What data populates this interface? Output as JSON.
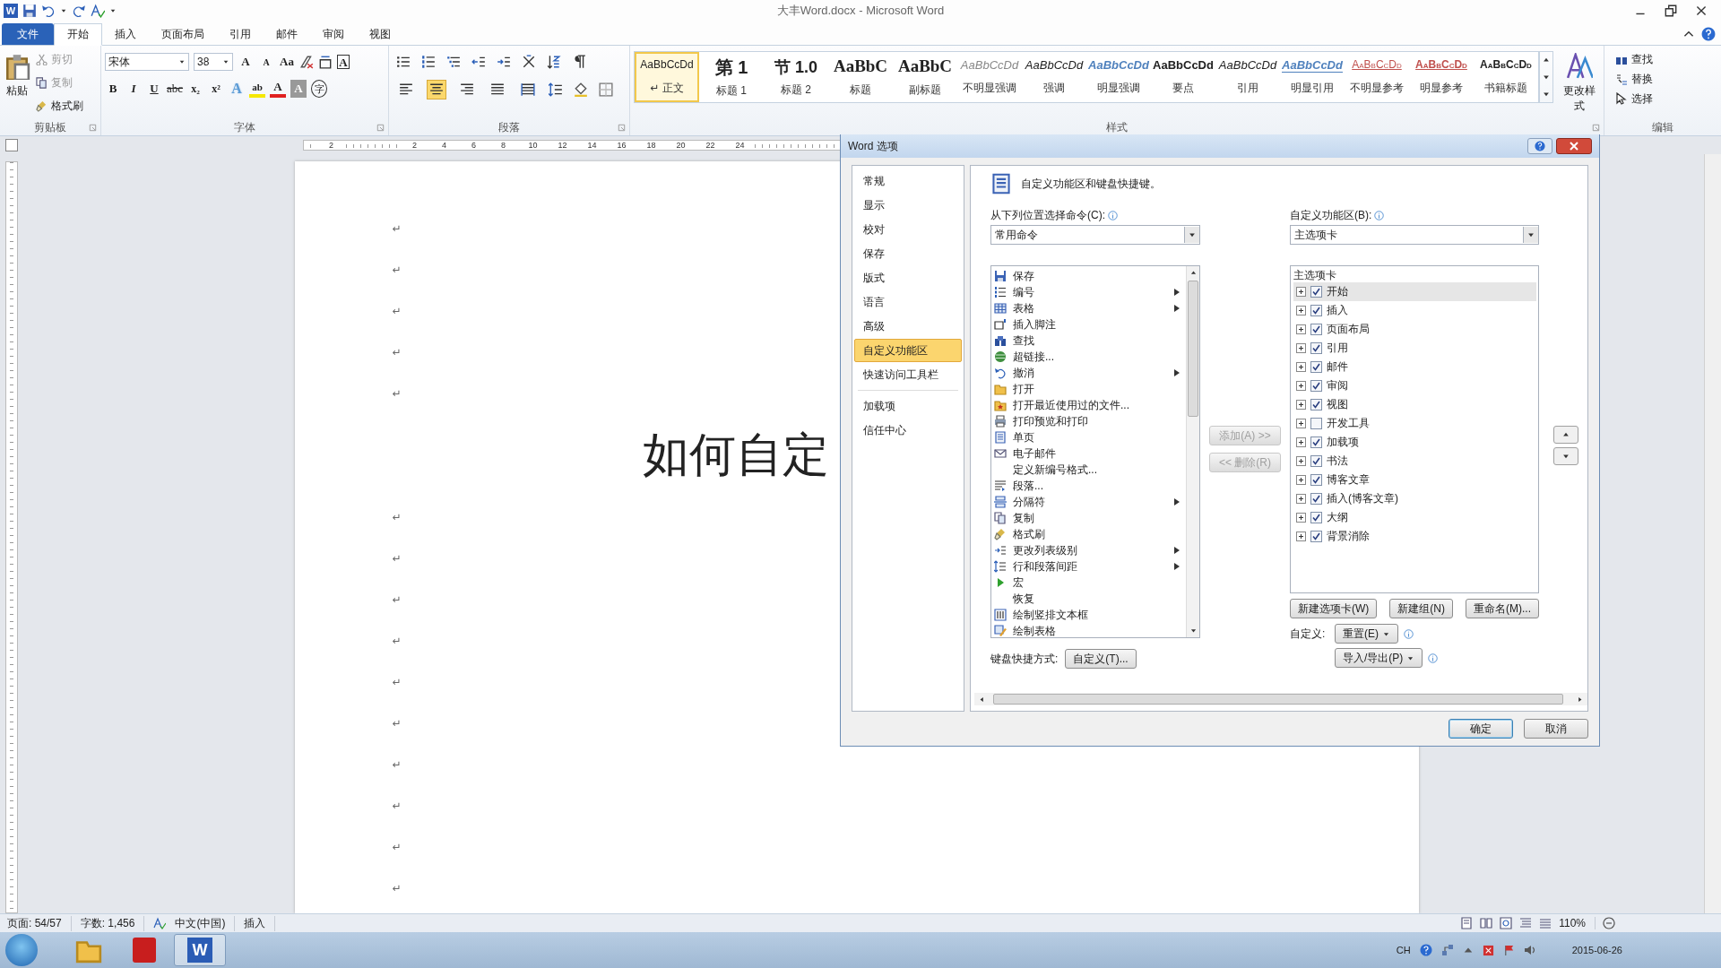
{
  "window": {
    "title": "大丰Word.docx - Microsoft Word",
    "logo": "W"
  },
  "ribbon_tabs": [
    {
      "label": "文件",
      "kind": "file",
      "selected": false
    },
    {
      "label": "开始",
      "kind": "tab",
      "selected": true
    },
    {
      "label": "插入",
      "kind": "tab",
      "selected": false
    },
    {
      "label": "页面布局",
      "kind": "tab",
      "selected": false
    },
    {
      "label": "引用",
      "kind": "tab",
      "selected": false
    },
    {
      "label": "邮件",
      "kind": "tab",
      "selected": false
    },
    {
      "label": "审阅",
      "kind": "tab",
      "selected": false
    },
    {
      "label": "视图",
      "kind": "tab",
      "selected": false
    }
  ],
  "clipboard": {
    "group": "剪贴板",
    "paste": "粘贴",
    "items": [
      {
        "label": "剪切",
        "disabled": true
      },
      {
        "label": "复制",
        "disabled": true
      },
      {
        "label": "格式刷",
        "disabled": false
      }
    ]
  },
  "font": {
    "group": "字体",
    "name": "宋体",
    "size": "38",
    "tools": [
      {
        "label": "A",
        "kind": "grow"
      },
      {
        "label": "A",
        "kind": "shrink"
      },
      {
        "label": "Aa",
        "kind": "case"
      },
      {
        "label": "A",
        "kind": "border"
      }
    ],
    "format_buttons": [
      {
        "label": "B",
        "kind": "bold"
      },
      {
        "label": "I",
        "kind": "italic"
      },
      {
        "label": "U",
        "kind": "underline"
      },
      {
        "label": "abc",
        "kind": "strike"
      },
      {
        "label": "x₂",
        "kind": "sub"
      },
      {
        "label": "x²",
        "kind": "sup"
      },
      {
        "label": "A",
        "kind": "effect"
      },
      {
        "label": "ab",
        "kind": "highlight"
      },
      {
        "label": "A",
        "kind": "color"
      },
      {
        "label": "A",
        "kind": "shade"
      },
      {
        "label": "字",
        "kind": "enclose"
      }
    ]
  },
  "paragraph": {
    "group": "段落",
    "alignment": [
      {
        "selected": false
      },
      {
        "selected": true
      },
      {
        "selected": false
      },
      {
        "selected": false
      },
      {
        "selected": false
      }
    ]
  },
  "styles": {
    "group": "样式",
    "change": "更改样式",
    "items": [
      {
        "preview": "AaBbCcDd",
        "name": "↵ 正文",
        "kind": "normal",
        "selected": true
      },
      {
        "preview": "第 1",
        "name": "标题 1",
        "kind": "h1",
        "selected": false
      },
      {
        "preview": "节 1.0",
        "name": "标题 2",
        "kind": "h2",
        "selected": false
      },
      {
        "preview": "AaBbC",
        "name": "标题",
        "kind": "title",
        "selected": false
      },
      {
        "preview": "AaBbC",
        "name": "副标题",
        "kind": "subtitle",
        "selected": false
      },
      {
        "preview": "AaBbCcDd",
        "name": "不明显强调",
        "kind": "subtle",
        "selected": false
      },
      {
        "preview": "AaBbCcDd",
        "name": "强调",
        "kind": "emph",
        "selected": false
      },
      {
        "preview": "AaBbCcDd",
        "name": "明显强调",
        "kind": "intense",
        "selected": false
      },
      {
        "preview": "AaBbCcDd",
        "name": "要点",
        "kind": "strong",
        "selected": false
      },
      {
        "preview": "AaBbCcDd",
        "name": "引用",
        "kind": "quote",
        "selected": false
      },
      {
        "preview": "AaBbCcDd",
        "name": "明显引用",
        "kind": "iquote",
        "selected": false
      },
      {
        "preview": "AaBbCcDd",
        "name": "不明显参考",
        "kind": "subref",
        "selected": false
      },
      {
        "preview": "AaBbCcDd",
        "name": "明显参考",
        "kind": "iref",
        "selected": false
      },
      {
        "preview": "AaBbCcDd",
        "name": "书籍标题",
        "kind": "book",
        "selected": false
      }
    ]
  },
  "editing": {
    "group": "编辑",
    "items": [
      "查找",
      "替换",
      "选择"
    ]
  },
  "ruler": {
    "labels": [
      "2",
      "2",
      "4",
      "6",
      "8",
      "10",
      "12",
      "14",
      "16",
      "18",
      "20",
      "22",
      "24"
    ]
  },
  "document": {
    "lines": [
      {
        "kind": "mark",
        "text": "↵"
      },
      {
        "kind": "mark",
        "text": "↵"
      },
      {
        "kind": "mark",
        "text": "↵"
      },
      {
        "kind": "mark",
        "text": "↵"
      },
      {
        "kind": "mark",
        "text": "↵"
      },
      {
        "kind": "title",
        "text": "如何自定"
      },
      {
        "kind": "mark",
        "text": "↵"
      },
      {
        "kind": "mark",
        "text": "↵"
      },
      {
        "kind": "mark",
        "text": "↵"
      },
      {
        "kind": "mark",
        "text": "↵"
      },
      {
        "kind": "mark",
        "text": "↵"
      },
      {
        "kind": "mark",
        "text": "↵"
      },
      {
        "kind": "mark",
        "text": "↵"
      },
      {
        "kind": "mark",
        "text": "↵"
      },
      {
        "kind": "mark",
        "text": "↵"
      },
      {
        "kind": "mark",
        "text": "↵"
      }
    ]
  },
  "status_bar": {
    "items": [
      "页面: 54/57",
      "字数: 1,456",
      "中文(中国)",
      "插入"
    ],
    "zoom": "110%"
  },
  "taskbar": {
    "apps": [
      {
        "kind": "folder",
        "selected": false
      },
      {
        "kind": "pdf",
        "selected": false
      },
      {
        "kind": "word",
        "label": "W",
        "selected": true
      }
    ],
    "lang": "CH",
    "date": "2015-06-26"
  },
  "dialog": {
    "title": "Word 选项",
    "nav": [
      {
        "label": "常规",
        "selected": false
      },
      {
        "label": "显示",
        "selected": false
      },
      {
        "label": "校对",
        "selected": false
      },
      {
        "label": "保存",
        "selected": false
      },
      {
        "label": "版式",
        "selected": false
      },
      {
        "label": "语言",
        "selected": false
      },
      {
        "label": "高级",
        "selected": false
      },
      {
        "label": "自定义功能区",
        "selected": true
      },
      {
        "label": "快速访问工具栏",
        "selected": false
      },
      {
        "label": "加载项",
        "selected": false
      },
      {
        "label": "信任中心",
        "selected": false
      }
    ],
    "heading": "自定义功能区和键盘快捷键。",
    "commands_label": "从下列位置选择命令(C):",
    "commands_source": "常用命令",
    "commands": [
      {
        "label": "保存",
        "has_submenu": false
      },
      {
        "label": "编号",
        "has_submenu": true
      },
      {
        "label": "表格",
        "has_submenu": true
      },
      {
        "label": "插入脚注",
        "has_submenu": false
      },
      {
        "label": "查找",
        "has_submenu": false
      },
      {
        "label": "超链接...",
        "has_submenu": false
      },
      {
        "label": "撤消",
        "has_submenu": true
      },
      {
        "label": "打开",
        "has_submenu": false
      },
      {
        "label": "打开最近使用过的文件...",
        "has_submenu": false
      },
      {
        "label": "打印预览和打印",
        "has_submenu": false
      },
      {
        "label": "单页",
        "has_submenu": false
      },
      {
        "label": "电子邮件",
        "has_submenu": false
      },
      {
        "label": "定义新编号格式...",
        "has_submenu": false
      },
      {
        "label": "段落...",
        "has_submenu": false
      },
      {
        "label": "分隔符",
        "has_submenu": true
      },
      {
        "label": "复制",
        "has_submenu": false
      },
      {
        "label": "格式刷",
        "has_submenu": false
      },
      {
        "label": "更改列表级别",
        "has_submenu": true
      },
      {
        "label": "行和段落间距",
        "has_submenu": true
      },
      {
        "label": "宏",
        "has_submenu": false
      },
      {
        "label": "恢复",
        "has_submenu": false
      },
      {
        "label": "绘制竖排文本框",
        "has_submenu": false
      },
      {
        "label": "绘制表格",
        "has_submenu": false
      }
    ],
    "shortcut_label": "键盘快捷方式:",
    "shortcut_button": "自定义(T)...",
    "add_button": {
      "label": "添加(A) >>",
      "disabled": true
    },
    "remove_button": {
      "label": "<< 删除(R)",
      "disabled": true
    },
    "ribbon_label": "自定义功能区(B):",
    "ribbon_source": "主选项卡",
    "tree": {
      "header": "主选项卡",
      "items": [
        {
          "label": "开始",
          "checked": true,
          "expanded": false,
          "selected": true
        },
        {
          "label": "插入",
          "checked": true,
          "expanded": false,
          "selected": false
        },
        {
          "label": "页面布局",
          "checked": true,
          "expanded": false,
          "selected": false
        },
        {
          "label": "引用",
          "checked": true,
          "expanded": false,
          "selected": false
        },
        {
          "label": "邮件",
          "checked": true,
          "expanded": false,
          "selected": false
        },
        {
          "label": "审阅",
          "checked": true,
          "expanded": false,
          "selected": false
        },
        {
          "label": "视图",
          "checked": true,
          "expanded": false,
          "selected": false
        },
        {
          "label": "开发工具",
          "checked": false,
          "expanded": false,
          "selected": false
        },
        {
          "label": "加载项",
          "checked": true,
          "expanded": false,
          "selected": false
        },
        {
          "label": "书法",
          "checked": true,
          "expanded": false,
          "selected": false
        },
        {
          "label": "博客文章",
          "checked": true,
          "expanded": false,
          "selected": false
        },
        {
          "label": "插入(博客文章)",
          "checked": true,
          "expanded": false,
          "selected": false
        },
        {
          "label": "大纲",
          "checked": true,
          "expanded": false,
          "selected": false
        },
        {
          "label": "背景消除",
          "checked": true,
          "expanded": false,
          "selected": false
        }
      ]
    },
    "tree_buttons": [
      "新建选项卡(W)",
      "新建组(N)",
      "重命名(M)..."
    ],
    "customize_label": "自定义:",
    "reset_button": "重置(E)",
    "import_button": "导入/导出(P)",
    "ok": "确定",
    "cancel": "取消"
  }
}
